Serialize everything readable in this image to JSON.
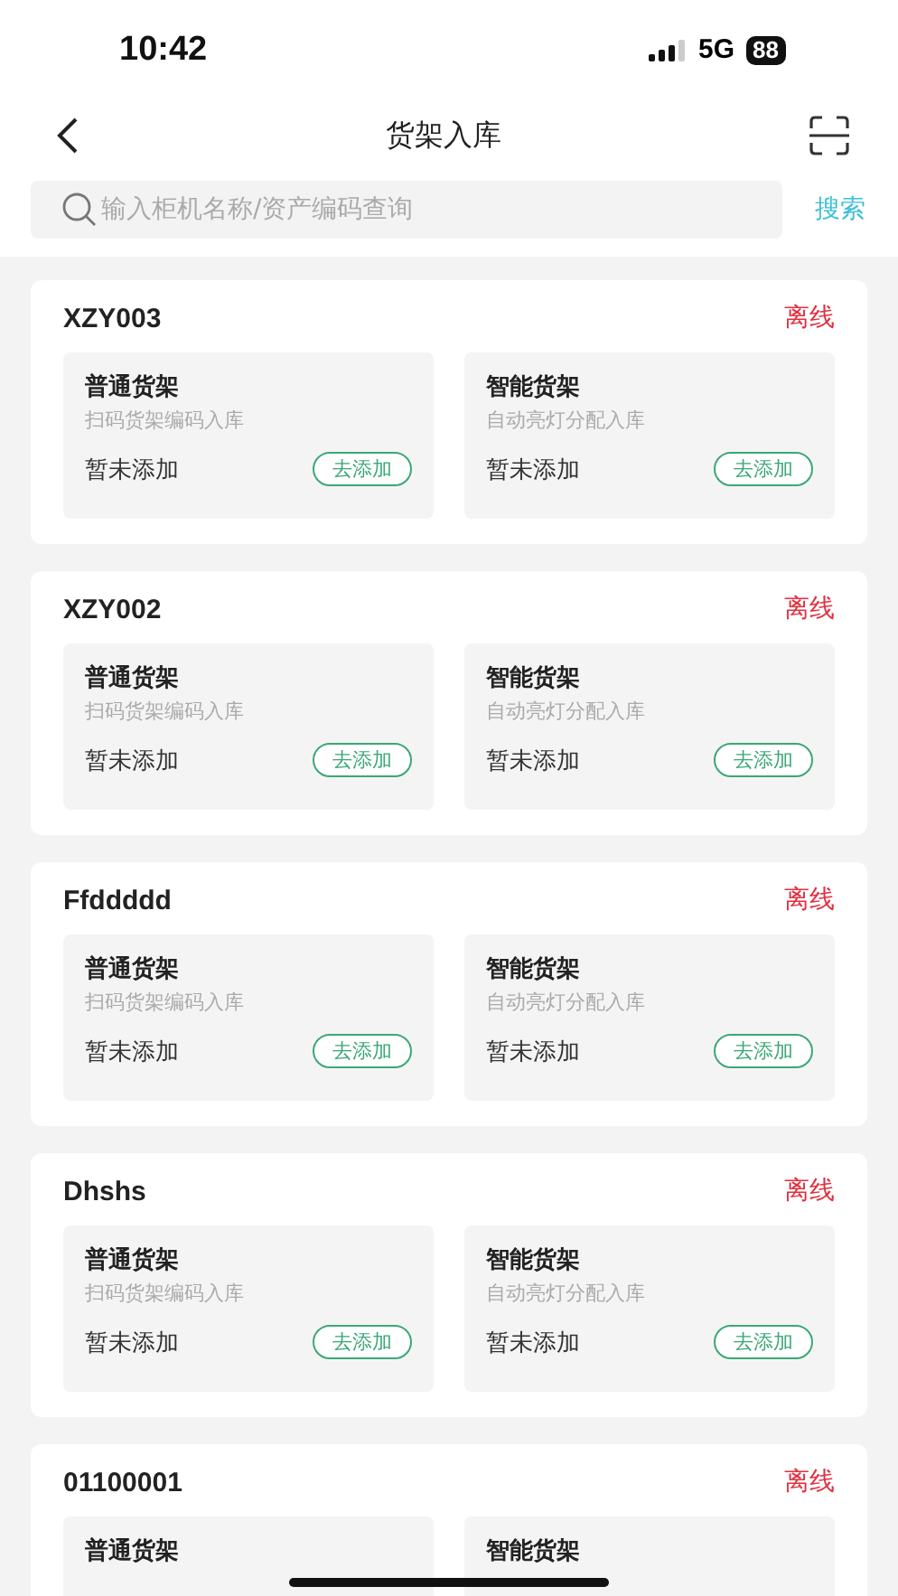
{
  "status_bar": {
    "time": "10:42",
    "network": "5G",
    "battery": "88"
  },
  "nav": {
    "title": "货架入库"
  },
  "search": {
    "placeholder": "输入柜机名称/资产编码查询",
    "button": "搜索"
  },
  "devices": [
    {
      "name": "XZY003",
      "status": "离线",
      "shelves": [
        {
          "title": "普通货架",
          "desc": "扫码货架编码入库",
          "state": "暂未添加",
          "action": "去添加"
        },
        {
          "title": "智能货架",
          "desc": "自动亮灯分配入库",
          "state": "暂未添加",
          "action": "去添加"
        }
      ]
    },
    {
      "name": "XZY002",
      "status": "离线",
      "shelves": [
        {
          "title": "普通货架",
          "desc": "扫码货架编码入库",
          "state": "暂未添加",
          "action": "去添加"
        },
        {
          "title": "智能货架",
          "desc": "自动亮灯分配入库",
          "state": "暂未添加",
          "action": "去添加"
        }
      ]
    },
    {
      "name": "Ffddddd",
      "status": "离线",
      "shelves": [
        {
          "title": "普通货架",
          "desc": "扫码货架编码入库",
          "state": "暂未添加",
          "action": "去添加"
        },
        {
          "title": "智能货架",
          "desc": "自动亮灯分配入库",
          "state": "暂未添加",
          "action": "去添加"
        }
      ]
    },
    {
      "name": "Dhshs",
      "status": "离线",
      "shelves": [
        {
          "title": "普通货架",
          "desc": "扫码货架编码入库",
          "state": "暂未添加",
          "action": "去添加"
        },
        {
          "title": "智能货架",
          "desc": "自动亮灯分配入库",
          "state": "暂未添加",
          "action": "去添加"
        }
      ]
    },
    {
      "name": "01100001",
      "status": "离线",
      "shelves": [
        {
          "title": "普通货架"
        },
        {
          "title": "智能货架"
        }
      ]
    }
  ]
}
